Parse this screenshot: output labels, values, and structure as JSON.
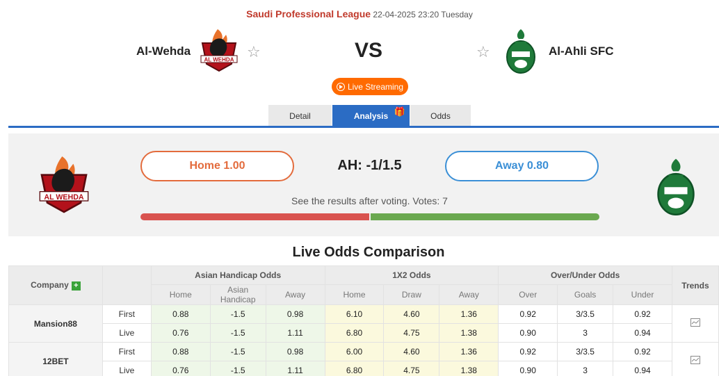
{
  "match": {
    "league": "Saudi Professional League",
    "datetime": "22-04-2025 23:20 Tuesday",
    "home_team": "Al-Wehda",
    "away_team": "Al-Ahli SFC",
    "vs": "VS",
    "live_label": "Live Streaming"
  },
  "tabs": [
    {
      "label": "Detail"
    },
    {
      "label": "Analysis"
    },
    {
      "label": "Odds"
    }
  ],
  "vote": {
    "home_label": "Home 1.00",
    "away_label": "Away 0.80",
    "handicap": "AH: -1/1.5",
    "note": "See the results after voting. Votes: 7",
    "home_share": 0.5
  },
  "odds_section": {
    "title": "Live Odds Comparison",
    "headers": {
      "company": "Company",
      "asian": "Asian Handicap Odds",
      "x12": "1X2 Odds",
      "ou": "Over/Under Odds",
      "trends": "Trends"
    },
    "subheaders": {
      "asian": [
        "Home",
        "Asian Handicap",
        "Away"
      ],
      "x12": [
        "Home",
        "Draw",
        "Away"
      ],
      "ou": [
        "Over",
        "Goals",
        "Under"
      ]
    },
    "rows": [
      {
        "company": "Mansion88",
        "first": {
          "type": "First",
          "ah": [
            "0.88",
            "-1.5",
            "0.98"
          ],
          "x12": [
            "6.10",
            "4.60",
            "1.36"
          ],
          "ou": [
            "0.92",
            "3/3.5",
            "0.92"
          ]
        },
        "live": {
          "type": "Live",
          "ah": [
            "0.76",
            "-1.5",
            "1.11"
          ],
          "x12": [
            "6.80",
            "4.75",
            "1.38"
          ],
          "ou": [
            "0.90",
            "3",
            "0.94"
          ]
        }
      },
      {
        "company": "12BET",
        "first": {
          "type": "First",
          "ah": [
            "0.88",
            "-1.5",
            "0.98"
          ],
          "x12": [
            "6.00",
            "4.60",
            "1.36"
          ],
          "ou": [
            "0.92",
            "3/3.5",
            "0.92"
          ]
        },
        "live": {
          "type": "Live",
          "ah": [
            "0.76",
            "-1.5",
            "1.11"
          ],
          "x12": [
            "6.80",
            "4.75",
            "1.38"
          ],
          "ou": [
            "0.90",
            "3",
            "0.94"
          ]
        }
      }
    ]
  },
  "colors": {
    "accent_blue": "#2b6cc4",
    "live_orange": "#ff6a00",
    "home_orange": "#e36b3c",
    "away_blue": "#3a8fd6",
    "league_red": "#c0392b"
  }
}
